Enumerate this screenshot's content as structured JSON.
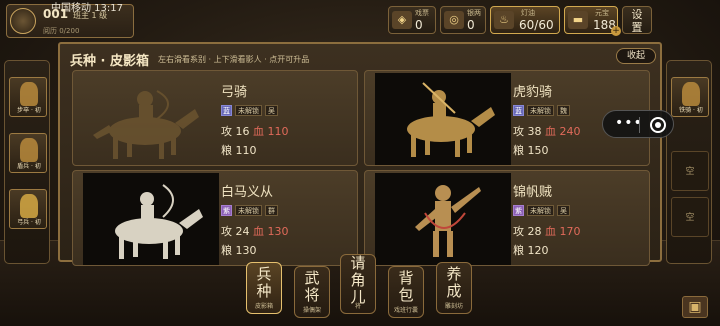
{
  "status_bar": {
    "carrier_time": "中国移动 13:17"
  },
  "player": {
    "id": "001",
    "rank": "班主 1 级",
    "exp": "阅历 0/200"
  },
  "resources": [
    {
      "label": "戏票",
      "value": "0",
      "icon": "ticket-icon"
    },
    {
      "label": "银两",
      "value": "0",
      "icon": "silver-icon"
    },
    {
      "label": "灯油",
      "value": "60/60",
      "icon": "lamp-oil-icon"
    },
    {
      "label": "元宝",
      "value": "188",
      "icon": "gold-ingot-icon"
    }
  ],
  "settings_label": "设置",
  "dialog": {
    "title": "兵种 · 皮影箱",
    "hint": "左右滑看系别 · 上下滑看影人 · 点开可升品",
    "collapse_label": "收起"
  },
  "cards": [
    {
      "name": "弓骑",
      "tags": [
        "未解锁",
        "吴"
      ],
      "attack": "攻 16",
      "hp": "血 110",
      "food": "粮 110"
    },
    {
      "name": "虎豹骑",
      "tags": [
        "未解锁",
        "魏"
      ],
      "attack": "攻 38",
      "hp": "血 240",
      "food": "粮 150"
    },
    {
      "name": "白马义从",
      "tags": [
        "未解锁",
        "群"
      ],
      "attack": "攻 24",
      "hp": "血 130",
      "food": "粮 130"
    },
    {
      "name": "锦帆贼",
      "tags": [
        "未解锁",
        "吴"
      ],
      "attack": "攻 28",
      "hp": "血 170",
      "food": "粮 120"
    }
  ],
  "left_slots": [
    "步卒 · 初",
    "盾兵 · 初",
    "弓兵 · 初"
  ],
  "right_slots": {
    "filled": "铁骑 · 初",
    "empty": [
      "空",
      "空"
    ]
  },
  "nav": [
    {
      "big": "兵种",
      "small": "皮影箱",
      "active": true
    },
    {
      "big": "武将",
      "small": "操偶架",
      "active": false
    },
    {
      "big": "请角儿",
      "small": "将",
      "active": false
    },
    {
      "big": "背包",
      "small": "戏班行囊",
      "active": false
    },
    {
      "big": "养成",
      "small": "雕刻坊",
      "active": false
    }
  ]
}
